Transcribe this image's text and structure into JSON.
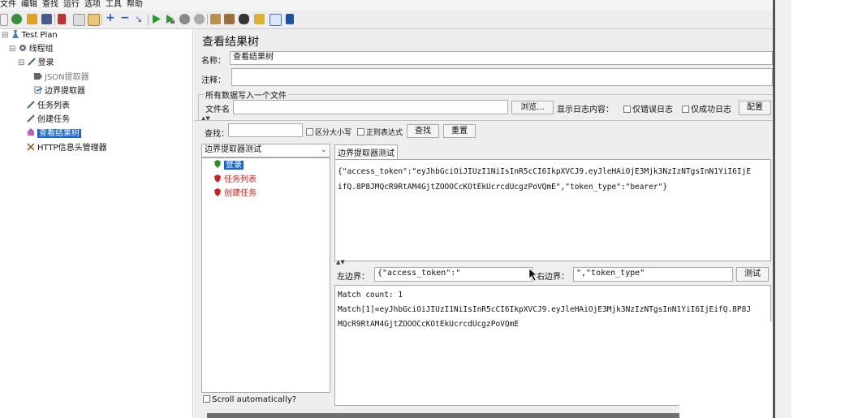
{
  "menu": [
    "文件",
    "编辑",
    "查找",
    "运行",
    "选项",
    "工具",
    "帮助"
  ],
  "tree": {
    "items": [
      {
        "label": "Test Plan",
        "level": 0,
        "icon": "flask-icon"
      },
      {
        "label": "线程组",
        "level": 1,
        "icon": "gear-icon"
      },
      {
        "label": "登录",
        "level": 2,
        "icon": "sampler-icon"
      },
      {
        "label": "JSON提取器",
        "level": 3,
        "icon": "extractor-icon"
      },
      {
        "label": "边界提取器",
        "level": 3,
        "icon": "extractor-icon"
      },
      {
        "label": "任务列表",
        "level": 2,
        "icon": "sampler-icon"
      },
      {
        "label": "创建任务",
        "level": 2,
        "icon": "sampler-icon"
      },
      {
        "label": "查看结果树",
        "level": 2,
        "icon": "listener-icon",
        "selected": true
      },
      {
        "label": "HTTP信息头管理器",
        "level": 2,
        "icon": "wrench-icon"
      }
    ]
  },
  "panel": {
    "title": "查看结果树",
    "name_label": "名称：",
    "name_value": "查看结果树",
    "comment_label": "注释：",
    "write_all_label": "所有数据写入一个文件",
    "filename_label": "文件名",
    "browse_btn": "浏览...",
    "show_log_label": "显示日志内容：",
    "errors_only": "仅错误日志",
    "success_only": "仅成功日志",
    "config_btn": "配置",
    "search_label": "查找：",
    "case_sensitive": "区分大小写",
    "regex": "正则表达式",
    "find_btn": "查找",
    "reset_btn": "重置",
    "renderer_select": "边界提取器测试",
    "results": [
      {
        "label": "登录",
        "status": "success",
        "selected": true
      },
      {
        "label": "任务列表",
        "status": "error"
      },
      {
        "label": "创建任务",
        "status": "error"
      }
    ],
    "scroll_auto": "Scroll automatically?",
    "tab_label": "边界提取器测试",
    "response_line1": "{\"access_token\":\"eyJhbGciOiJIUzI1NiIsInR5cCI6IkpXVCJ9.eyJleHAiOjE3Mjk3NzIzNTgsInN1YiI6IjE",
    "response_line2": "ifQ.8P8JMQcR9RtAM4GjtZOOOCcKOtEkUcrcdUcgzPoVQmE\",\"token_type\":\"bearer\"}",
    "left_boundary_label": "左边界：",
    "left_boundary_value": "{\"access_token\":\"",
    "right_boundary_label": "右边界：",
    "right_boundary_value": "\",\"token_type\"",
    "test_btn": "测试",
    "match_count": "Match count: 1",
    "match_line1": "Match[1]=eyJhbGciOiJIUzI1NiIsInR5cCI6IkpXVCJ9.eyJleHAiOjE3Mjk3NzIzNTgsInN1YiI6IjEifQ.8P8J",
    "match_line2": "MQcR9RtAM4GjtZOOOCcKOtEkUcrcdUcgzPoVQmE"
  },
  "colors": {
    "selection": "#1b65d2",
    "error": "#cc2222",
    "success": "#2e8b2e"
  }
}
